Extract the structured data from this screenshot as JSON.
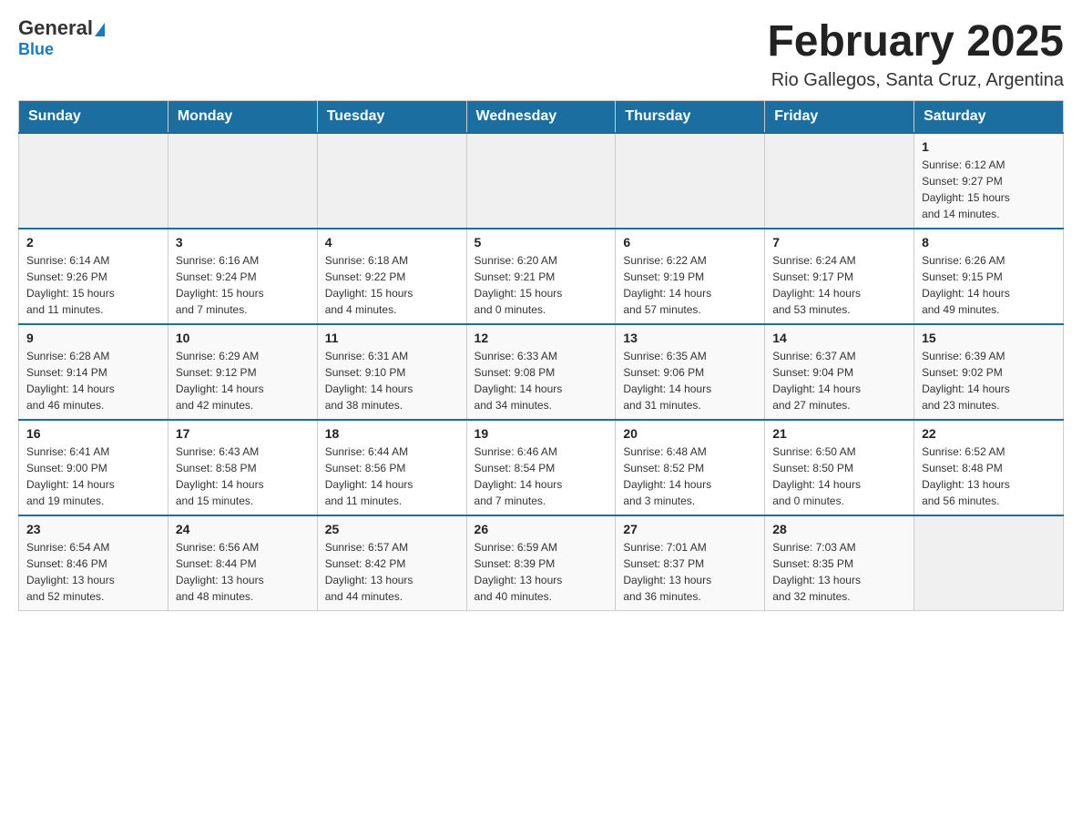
{
  "header": {
    "logo_general": "General",
    "logo_blue": "Blue",
    "title": "February 2025",
    "subtitle": "Rio Gallegos, Santa Cruz, Argentina"
  },
  "weekdays": [
    "Sunday",
    "Monday",
    "Tuesday",
    "Wednesday",
    "Thursday",
    "Friday",
    "Saturday"
  ],
  "weeks": [
    [
      {
        "day": "",
        "info": ""
      },
      {
        "day": "",
        "info": ""
      },
      {
        "day": "",
        "info": ""
      },
      {
        "day": "",
        "info": ""
      },
      {
        "day": "",
        "info": ""
      },
      {
        "day": "",
        "info": ""
      },
      {
        "day": "1",
        "info": "Sunrise: 6:12 AM\nSunset: 9:27 PM\nDaylight: 15 hours\nand 14 minutes."
      }
    ],
    [
      {
        "day": "2",
        "info": "Sunrise: 6:14 AM\nSunset: 9:26 PM\nDaylight: 15 hours\nand 11 minutes."
      },
      {
        "day": "3",
        "info": "Sunrise: 6:16 AM\nSunset: 9:24 PM\nDaylight: 15 hours\nand 7 minutes."
      },
      {
        "day": "4",
        "info": "Sunrise: 6:18 AM\nSunset: 9:22 PM\nDaylight: 15 hours\nand 4 minutes."
      },
      {
        "day": "5",
        "info": "Sunrise: 6:20 AM\nSunset: 9:21 PM\nDaylight: 15 hours\nand 0 minutes."
      },
      {
        "day": "6",
        "info": "Sunrise: 6:22 AM\nSunset: 9:19 PM\nDaylight: 14 hours\nand 57 minutes."
      },
      {
        "day": "7",
        "info": "Sunrise: 6:24 AM\nSunset: 9:17 PM\nDaylight: 14 hours\nand 53 minutes."
      },
      {
        "day": "8",
        "info": "Sunrise: 6:26 AM\nSunset: 9:15 PM\nDaylight: 14 hours\nand 49 minutes."
      }
    ],
    [
      {
        "day": "9",
        "info": "Sunrise: 6:28 AM\nSunset: 9:14 PM\nDaylight: 14 hours\nand 46 minutes."
      },
      {
        "day": "10",
        "info": "Sunrise: 6:29 AM\nSunset: 9:12 PM\nDaylight: 14 hours\nand 42 minutes."
      },
      {
        "day": "11",
        "info": "Sunrise: 6:31 AM\nSunset: 9:10 PM\nDaylight: 14 hours\nand 38 minutes."
      },
      {
        "day": "12",
        "info": "Sunrise: 6:33 AM\nSunset: 9:08 PM\nDaylight: 14 hours\nand 34 minutes."
      },
      {
        "day": "13",
        "info": "Sunrise: 6:35 AM\nSunset: 9:06 PM\nDaylight: 14 hours\nand 31 minutes."
      },
      {
        "day": "14",
        "info": "Sunrise: 6:37 AM\nSunset: 9:04 PM\nDaylight: 14 hours\nand 27 minutes."
      },
      {
        "day": "15",
        "info": "Sunrise: 6:39 AM\nSunset: 9:02 PM\nDaylight: 14 hours\nand 23 minutes."
      }
    ],
    [
      {
        "day": "16",
        "info": "Sunrise: 6:41 AM\nSunset: 9:00 PM\nDaylight: 14 hours\nand 19 minutes."
      },
      {
        "day": "17",
        "info": "Sunrise: 6:43 AM\nSunset: 8:58 PM\nDaylight: 14 hours\nand 15 minutes."
      },
      {
        "day": "18",
        "info": "Sunrise: 6:44 AM\nSunset: 8:56 PM\nDaylight: 14 hours\nand 11 minutes."
      },
      {
        "day": "19",
        "info": "Sunrise: 6:46 AM\nSunset: 8:54 PM\nDaylight: 14 hours\nand 7 minutes."
      },
      {
        "day": "20",
        "info": "Sunrise: 6:48 AM\nSunset: 8:52 PM\nDaylight: 14 hours\nand 3 minutes."
      },
      {
        "day": "21",
        "info": "Sunrise: 6:50 AM\nSunset: 8:50 PM\nDaylight: 14 hours\nand 0 minutes."
      },
      {
        "day": "22",
        "info": "Sunrise: 6:52 AM\nSunset: 8:48 PM\nDaylight: 13 hours\nand 56 minutes."
      }
    ],
    [
      {
        "day": "23",
        "info": "Sunrise: 6:54 AM\nSunset: 8:46 PM\nDaylight: 13 hours\nand 52 minutes."
      },
      {
        "day": "24",
        "info": "Sunrise: 6:56 AM\nSunset: 8:44 PM\nDaylight: 13 hours\nand 48 minutes."
      },
      {
        "day": "25",
        "info": "Sunrise: 6:57 AM\nSunset: 8:42 PM\nDaylight: 13 hours\nand 44 minutes."
      },
      {
        "day": "26",
        "info": "Sunrise: 6:59 AM\nSunset: 8:39 PM\nDaylight: 13 hours\nand 40 minutes."
      },
      {
        "day": "27",
        "info": "Sunrise: 7:01 AM\nSunset: 8:37 PM\nDaylight: 13 hours\nand 36 minutes."
      },
      {
        "day": "28",
        "info": "Sunrise: 7:03 AM\nSunset: 8:35 PM\nDaylight: 13 hours\nand 32 minutes."
      },
      {
        "day": "",
        "info": ""
      }
    ]
  ]
}
